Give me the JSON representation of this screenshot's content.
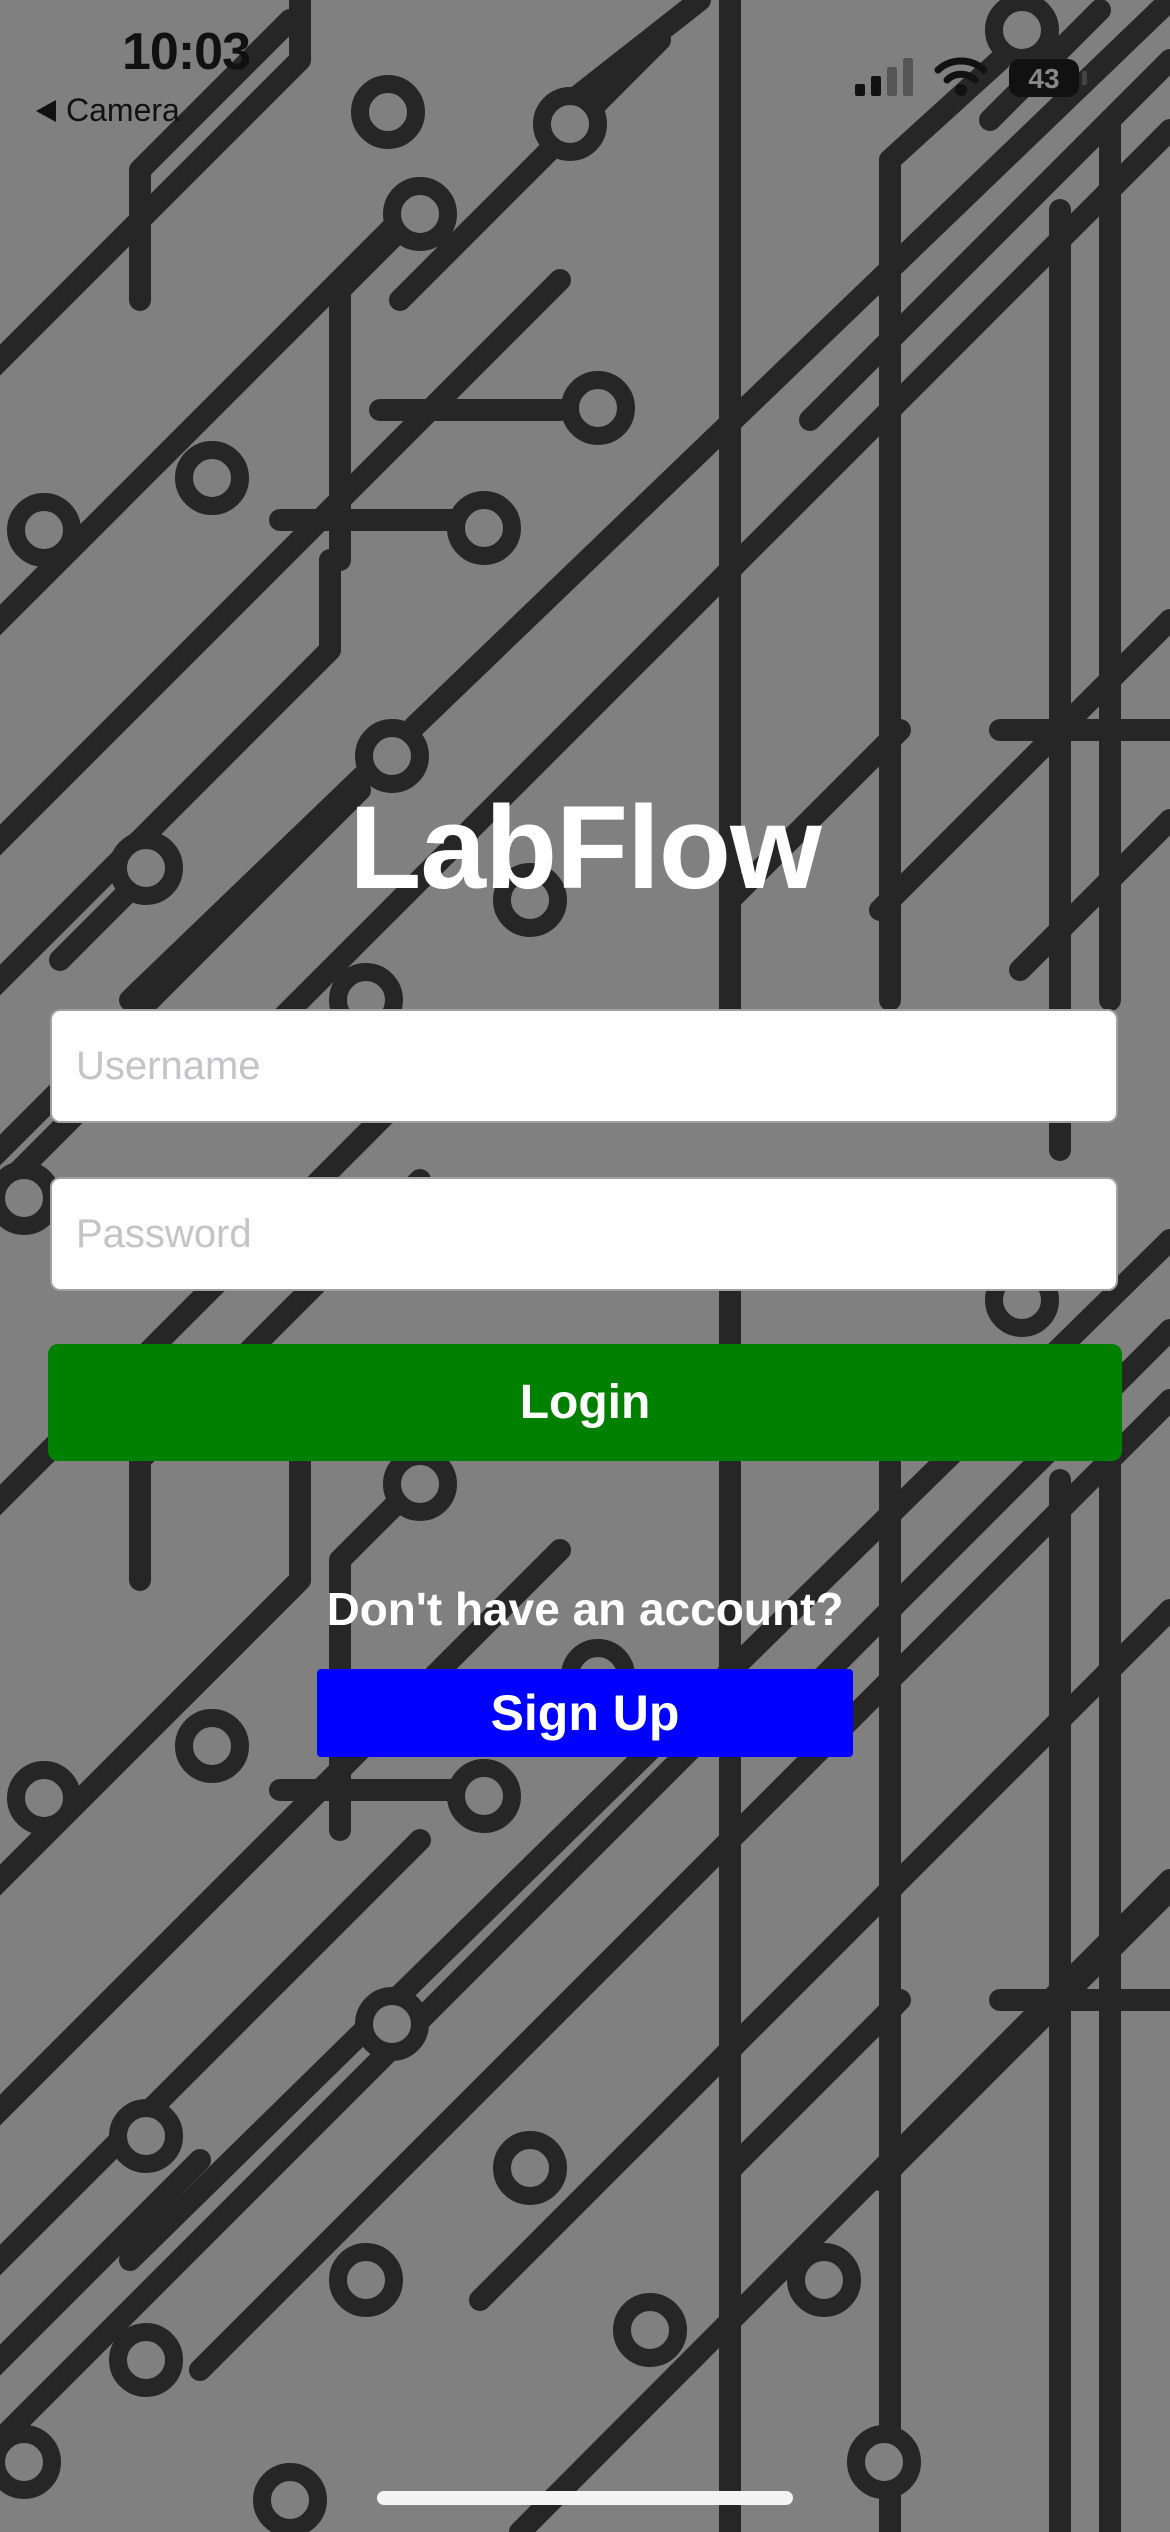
{
  "status_bar": {
    "time": "10:03",
    "back_label": "Camera",
    "battery": "43"
  },
  "login": {
    "title": "LabFlow",
    "username_placeholder": "Username",
    "password_placeholder": "Password",
    "login_label": "Login",
    "signup_prompt": "Don't have an account?",
    "signup_label": "Sign Up"
  },
  "colors": {
    "background": "#808080",
    "circuit": "#222222",
    "login_button": "#008000",
    "signup_button": "#0000ff",
    "text": "#ffffff"
  }
}
